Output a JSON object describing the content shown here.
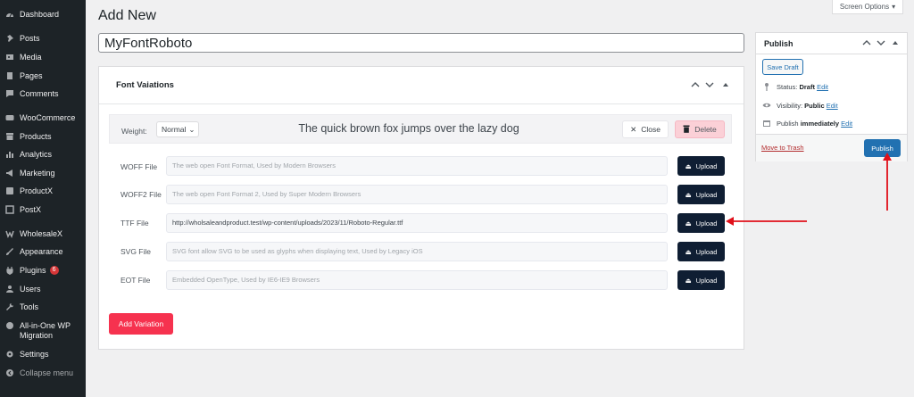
{
  "sidebar": {
    "items": [
      {
        "label": "Dashboard",
        "icon": "dashboard-icon"
      },
      {
        "label": "Posts",
        "icon": "pin-icon"
      },
      {
        "label": "Media",
        "icon": "media-icon"
      },
      {
        "label": "Pages",
        "icon": "page-icon"
      },
      {
        "label": "Comments",
        "icon": "comment-icon"
      },
      {
        "label": "WooCommerce",
        "icon": "woocommerce-icon"
      },
      {
        "label": "Products",
        "icon": "archive-icon"
      },
      {
        "label": "Analytics",
        "icon": "chart-icon"
      },
      {
        "label": "Marketing",
        "icon": "megaphone-icon"
      },
      {
        "label": "ProductX",
        "icon": "productx-icon"
      },
      {
        "label": "PostX",
        "icon": "postx-icon"
      },
      {
        "label": "WholesaleX",
        "icon": "wholesalex-icon"
      },
      {
        "label": "Appearance",
        "icon": "brush-icon"
      },
      {
        "label": "Plugins",
        "icon": "plugin-icon",
        "badge": "6"
      },
      {
        "label": "Users",
        "icon": "user-icon"
      },
      {
        "label": "Tools",
        "icon": "wrench-icon"
      },
      {
        "label": "All-in-One WP",
        "label2": "Migration",
        "icon": "migration-icon"
      },
      {
        "label": "Settings",
        "icon": "settings-icon"
      },
      {
        "label": "Collapse menu",
        "icon": "collapse-icon"
      }
    ]
  },
  "header": {
    "title": "Add New",
    "screen_options": "Screen Options"
  },
  "post_title": {
    "value": "MyFontRoboto"
  },
  "font_variations": {
    "title": "Font Vaiations",
    "weight_label": "Weight:",
    "weight_value": "Normal",
    "preview_text": "The quick brown fox jumps over the lazy dog",
    "close_label": "Close",
    "delete_label": "Delete",
    "upload_label": "Upload",
    "files": [
      {
        "label": "WOFF File",
        "value": "",
        "placeholder": "The web open Font Format, Used by Modern Browsers"
      },
      {
        "label": "WOFF2 File",
        "value": "",
        "placeholder": "The web open Font Format 2, Used by Super Modern Browsers"
      },
      {
        "label": "TTF File",
        "value": "http://wholsaleandproduct.test/wp-content/uploads/2023/11/Roboto-Regular.ttf",
        "placeholder": ""
      },
      {
        "label": "SVG File",
        "value": "",
        "placeholder": "SVG font allow SVG to be used as glyphs when displaying text, Used by Legacy iOS"
      },
      {
        "label": "EOT File",
        "value": "",
        "placeholder": "Embedded OpenType, Used by IE6-IE9 Browsers"
      }
    ],
    "add_variation_label": "Add Variation"
  },
  "publish": {
    "title": "Publish",
    "save_draft": "Save Draft",
    "status_label": "Status:",
    "status_value": "Draft",
    "visibility_label": "Visibility:",
    "visibility_value": "Public",
    "publish_label": "Publish",
    "publish_value": "immediately",
    "edit_link": "Edit",
    "move_to_trash": "Move to Trash",
    "publish_button": "Publish"
  },
  "colors": {
    "sidebar_bg": "#1d2327",
    "primary": "#2271b1",
    "upload_button": "#0f1e33",
    "add_variation": "#f6324f",
    "delete_bg": "#fbd0d7",
    "annotation_arrow": "#e0101a"
  }
}
